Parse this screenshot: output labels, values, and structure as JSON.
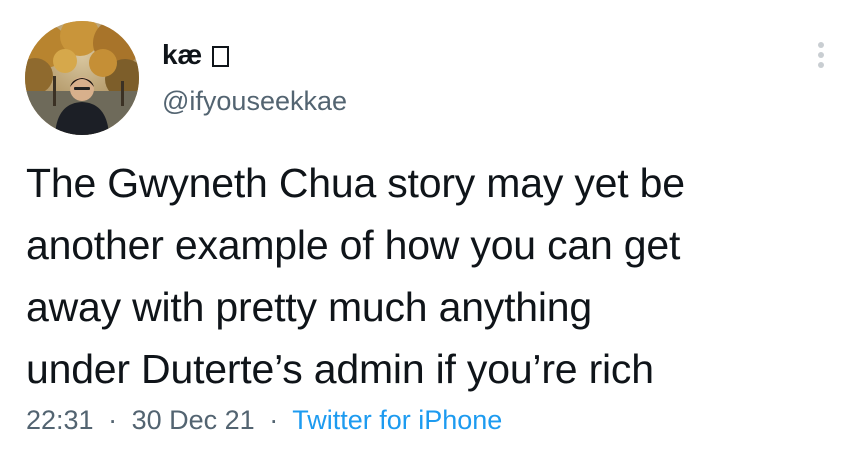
{
  "author": {
    "display_name": "kæ",
    "name_glyph": "missing-glyph-box",
    "handle": "@ifyouseekkae",
    "avatar_icon": "profile-photo-person-autumn-trees"
  },
  "tweet": {
    "text": "The Gwyneth Chua story may yet be\nanother example of how you can get\naway with pretty much anything\nunder Duterte’s admin if you’re rich",
    "time": "22:31",
    "date": "30 Dec 21",
    "separator": "·",
    "source": "Twitter for iPhone"
  },
  "more_icon": "more-vertical-icon",
  "colors": {
    "text": "#0f1419",
    "secondary": "#536471",
    "link": "#1d9bf0",
    "more_dots": "#c9ced2"
  }
}
